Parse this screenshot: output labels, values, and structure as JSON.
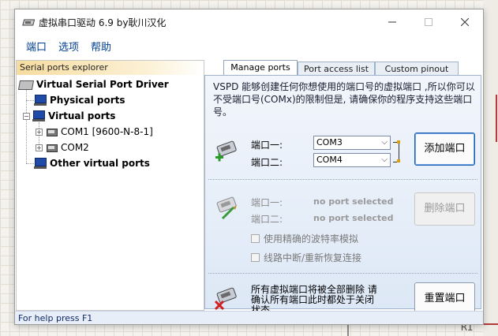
{
  "window": {
    "title": "虚拟串口驱动 6.9 by耿川汉化"
  },
  "menu": [
    "端口",
    "选项",
    "帮助"
  ],
  "tree": {
    "header": "Serial ports explorer",
    "root": "Virtual Serial Port Driver",
    "physical": "Physical ports",
    "virtual": "Virtual ports",
    "com1": "COM1 [9600-N-8-1]",
    "com2": "COM2",
    "other": "Other virtual ports"
  },
  "tabs": [
    "Manage ports",
    "Port access list",
    "Custom pinout"
  ],
  "description": "VSPD 能够创建任何你想使用的端口号的虚拟端口 ,所以你可以不受端口号(COMx)的限制但是, 请确保你的程序支持这些端口号。",
  "add": {
    "label1": "端口一:",
    "label2": "端口二:",
    "port1": "COM3",
    "port2": "COM4",
    "button": "添加端口"
  },
  "delete": {
    "label1": "端口一:",
    "label2": "端口二:",
    "value1": "no port selected",
    "value2": "no port selected",
    "button": "删除端口",
    "check1": "使用精确的波特率模拟",
    "check2": "线路中断/重新恢复连接"
  },
  "reset": {
    "note": "所有虚拟端口将被全部删除 请确认所有端口此时都处于关闭状态。",
    "button": "重置端口"
  },
  "status": "For help press F1",
  "background": {
    "text": "RI"
  }
}
